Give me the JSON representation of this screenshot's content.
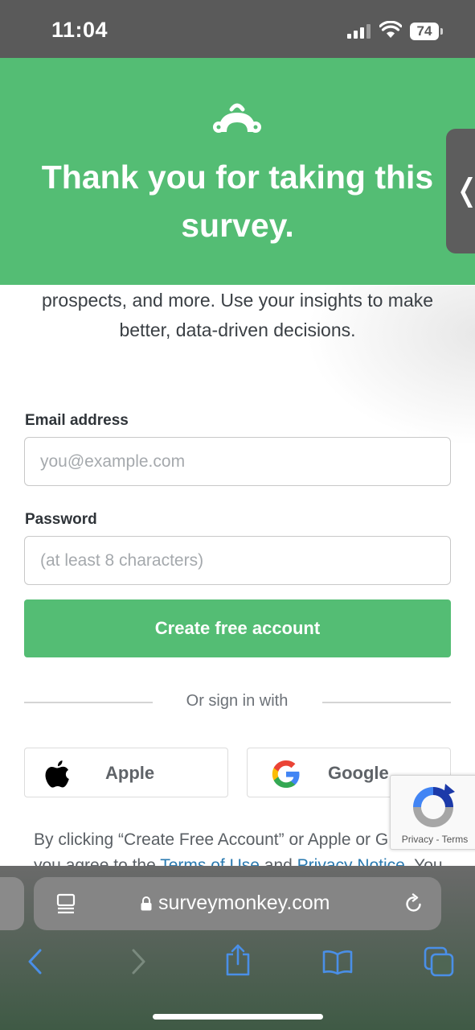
{
  "status_bar": {
    "time": "11:04",
    "battery": "74"
  },
  "header": {
    "title": "Thank you for taking this survey.",
    "background": "#54bd74"
  },
  "intro_text": "prospects, and more. Use your insights to make better, data-driven decisions.",
  "form": {
    "email_label": "Email address",
    "email_placeholder": "you@example.com",
    "email_value": "",
    "password_label": "Password",
    "password_placeholder": "(at least 8 characters)",
    "password_value": "",
    "submit_label": "Create free account"
  },
  "social": {
    "divider_text": "Or sign in with",
    "apple_label": "Apple",
    "google_label": "Google"
  },
  "recaptcha": {
    "privacy": "Privacy",
    "separator": "-",
    "terms": "Terms"
  },
  "legal": {
    "line1": "By clicking “Create Free Account” or Apple or G",
    "line2_prefix": "you agree to the ",
    "terms_link": "Terms of Use",
    "and": " and ",
    "privacy_link": "Privacy Notice",
    "line2_suffix": ". You"
  },
  "browser": {
    "url": "surveymonkey.com"
  },
  "icons": {
    "logo": "surveymonkey-logo-icon",
    "side_tab": "chevron-left-icon",
    "reader": "reader-mode-icon",
    "lock": "lock-icon",
    "reload": "reload-icon",
    "back": "back-arrow-icon",
    "forward": "forward-arrow-icon",
    "share": "share-icon",
    "bookmarks": "bookmarks-icon",
    "tabs": "tabs-icon"
  }
}
